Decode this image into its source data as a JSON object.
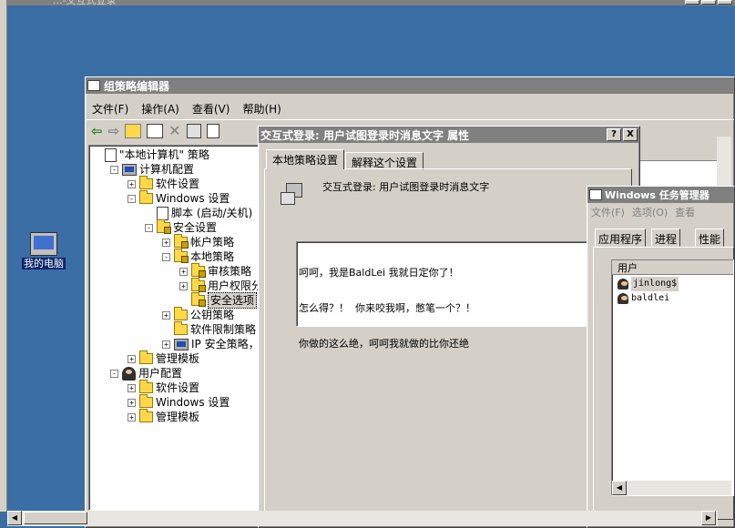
{
  "desktop": {
    "top_window_title": "...-交互式登录",
    "icon_label": "我的电脑"
  },
  "gpedit": {
    "title": "组策略编辑器",
    "menu": [
      "文件(F)",
      "操作(A)",
      "查看(V)",
      "帮助(H)"
    ],
    "tree": [
      {
        "label": "\"本地计算机\" 策略",
        "level": 0,
        "icon": "doc-icon"
      },
      {
        "label": "计算机配置",
        "level": 1,
        "icon": "computer-icon",
        "expander": "-"
      },
      {
        "label": "软件设置",
        "level": 2,
        "icon": "folder-icon",
        "expander": "+"
      },
      {
        "label": "Windows 设置",
        "level": 2,
        "icon": "folder-icon",
        "expander": "-"
      },
      {
        "label": "脚本 (启动/关机)",
        "level": 3,
        "icon": "doc-icon"
      },
      {
        "label": "安全设置",
        "level": 3,
        "icon": "security-folder-icon",
        "expander": "-"
      },
      {
        "label": "帐户策略",
        "level": 4,
        "icon": "security-folder-icon",
        "expander": "+"
      },
      {
        "label": "本地策略",
        "level": 4,
        "icon": "security-folder-icon",
        "expander": "-"
      },
      {
        "label": "审核策略",
        "level": 5,
        "icon": "security-folder-icon",
        "expander": "+"
      },
      {
        "label": "用户权限分配",
        "level": 5,
        "icon": "security-folder-icon",
        "expander": "+"
      },
      {
        "label": "安全选项",
        "level": 5,
        "icon": "security-folder-icon",
        "selected": true
      },
      {
        "label": "公钥策略",
        "level": 4,
        "icon": "folder-icon",
        "expander": "+"
      },
      {
        "label": "软件限制策略",
        "level": 4,
        "icon": "folder-icon"
      },
      {
        "label": "IP 安全策略，在",
        "level": 4,
        "icon": "computer-icon",
        "expander": "+"
      },
      {
        "label": "管理模板",
        "level": 2,
        "icon": "folder-icon",
        "expander": "+"
      },
      {
        "label": "用户配置",
        "level": 1,
        "icon": "user-config-icon",
        "expander": "-"
      },
      {
        "label": "软件设置",
        "level": 2,
        "icon": "folder-icon",
        "expander": "+"
      },
      {
        "label": "Windows 设置",
        "level": 2,
        "icon": "folder-icon",
        "expander": "+"
      },
      {
        "label": "管理模板",
        "level": 2,
        "icon": "folder-icon",
        "expander": "+"
      }
    ]
  },
  "dialog": {
    "title": "交互式登录: 用户试图登录时消息文字 属性",
    "help_button": "?",
    "close_button": "X",
    "tabs": [
      "本地策略设置",
      "解释这个设置"
    ],
    "policy_name": "交互式登录: 用户试图登录时消息文字",
    "message_lines": [
      "呵呵，我是BaldLei 我就日定你了！",
      "怎么得？！  你来咬我啊，憋笔一个？！",
      "你做的这么绝，呵呵我就做的比你还绝"
    ]
  },
  "taskmgr": {
    "title": "Windows 任务管理器",
    "menu": [
      "文件(F)",
      "选项(O)",
      "查看"
    ],
    "tabs": [
      "应用程序",
      "进程",
      "性能"
    ],
    "column_header": "用户",
    "users": [
      "jinlong$",
      "baldlei"
    ]
  }
}
